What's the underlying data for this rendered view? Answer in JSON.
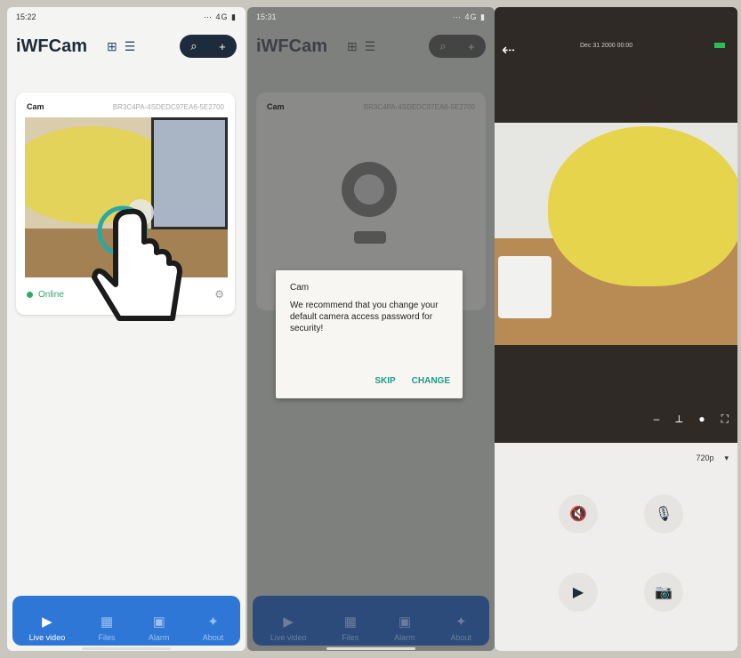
{
  "panel1": {
    "status": {
      "time": "15:22",
      "icons": "⋯ 4G ▮"
    },
    "app_title": "iWFCam",
    "card": {
      "name": "Cam",
      "id": "BR3C4PA-4SDEDC97EA6-5E2700",
      "status": "Online"
    },
    "nav": [
      {
        "label": "Live video",
        "icon": "▶"
      },
      {
        "label": "Files",
        "icon": "▦"
      },
      {
        "label": "Alarm",
        "icon": "▣"
      },
      {
        "label": "About",
        "icon": "✦"
      }
    ]
  },
  "panel2": {
    "status": {
      "time": "15:31",
      "icons": "⋯ 4G ▮"
    },
    "app_title": "iWFCam",
    "card": {
      "name": "Cam",
      "id": "BR3C4PA-4SDEDC97EA6-5E2700"
    },
    "dialog": {
      "title": "Cam",
      "message": "We recommend that you change your default camera access password for security!",
      "skip": "SKIP",
      "change": "CHANGE"
    },
    "nav": [
      {
        "label": "Live video",
        "icon": "▶"
      },
      {
        "label": "Files",
        "icon": "▦"
      },
      {
        "label": "Alarm",
        "icon": "▣"
      },
      {
        "label": "About",
        "icon": "✦"
      }
    ]
  },
  "panel3": {
    "timestamp": "Dec 31 2000 00:00",
    "quality": "720p",
    "video_controls": [
      "‒",
      "⟂",
      "●",
      "⛶"
    ],
    "buttons": [
      {
        "label": "speaker-mute",
        "glyph": "🔇"
      },
      {
        "label": "microphone",
        "glyph": "🎙"
      },
      {
        "label": "record",
        "glyph": "▶"
      },
      {
        "label": "snapshot",
        "glyph": "📷"
      }
    ]
  },
  "colors": {
    "accent": "#2f77d6",
    "online": "#2fa86a",
    "dialog_action": "#1f9c86"
  }
}
